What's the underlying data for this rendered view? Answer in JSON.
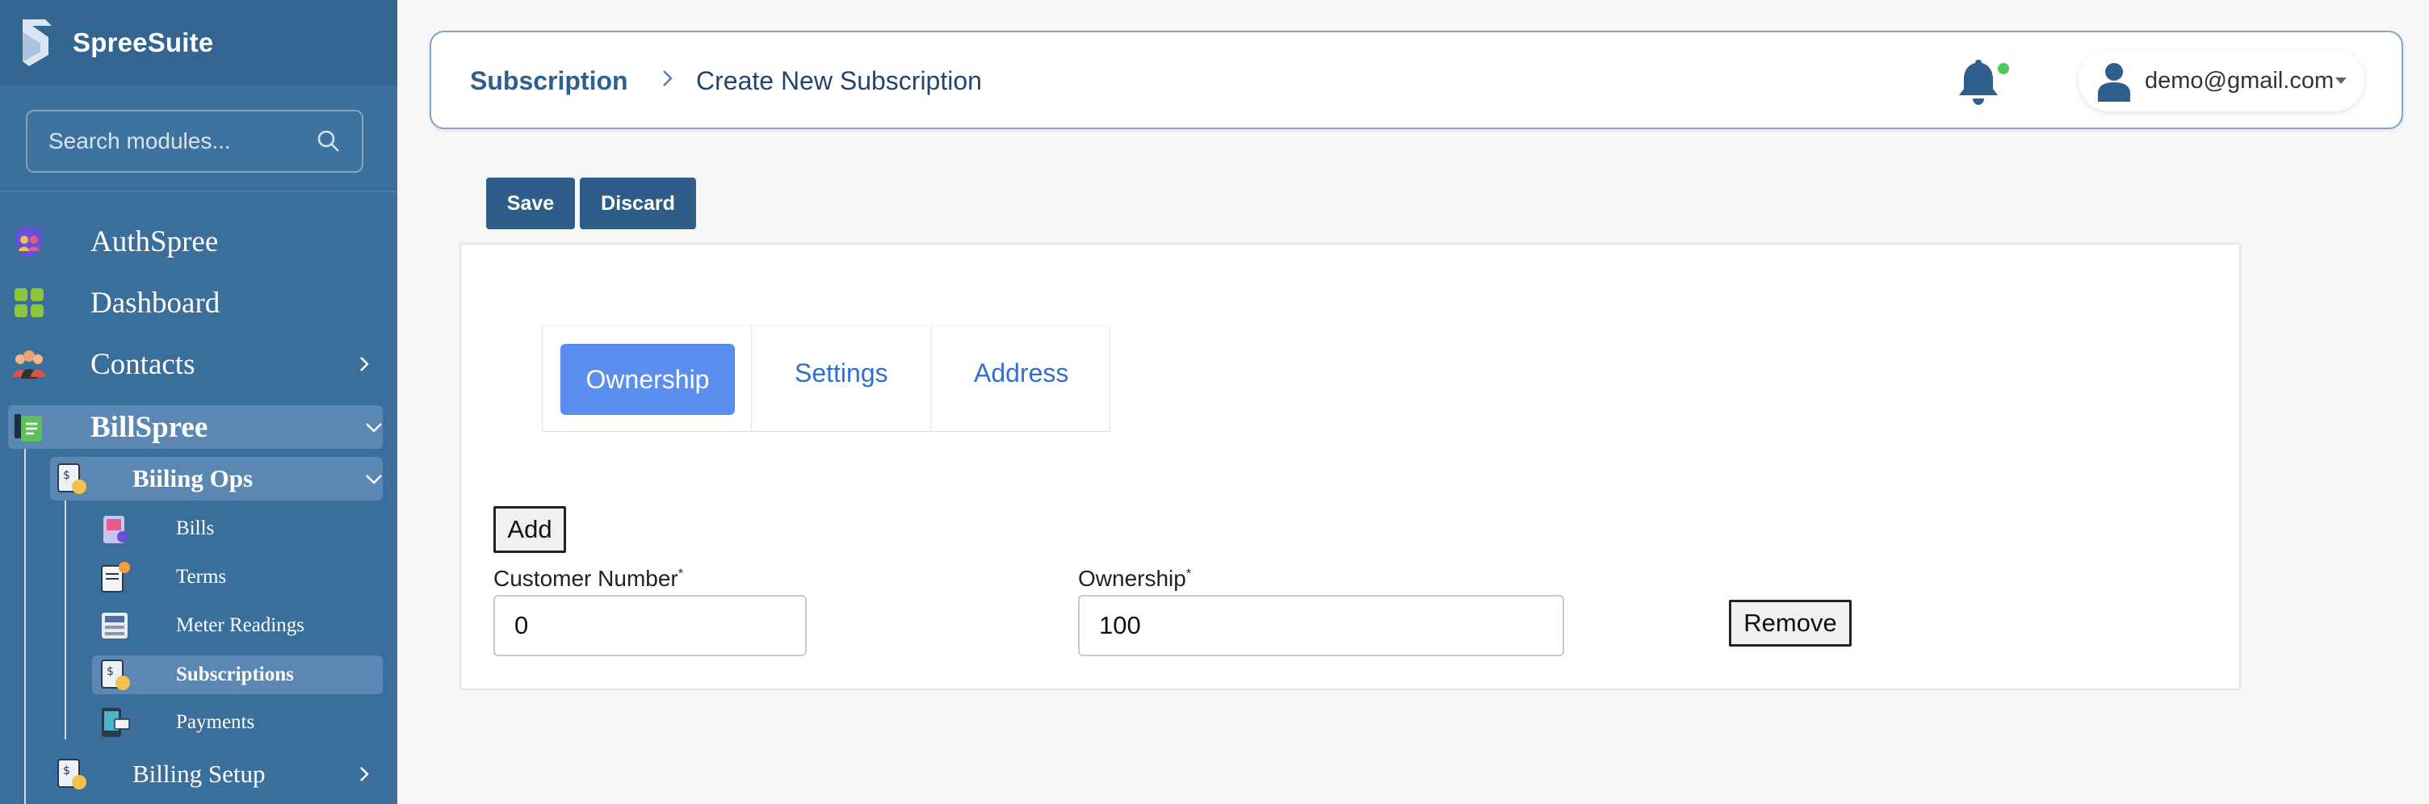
{
  "brand": {
    "name": "SpreeSuite"
  },
  "sidebar": {
    "search_placeholder": "Search modules...",
    "items": [
      {
        "label": "AuthSpree",
        "icon": "shield-users-icon"
      },
      {
        "label": "Dashboard",
        "icon": "dashboard-grid-icon"
      },
      {
        "label": "Contacts",
        "icon": "people-group-icon"
      },
      {
        "label": "BillSpree",
        "icon": "bill-document-icon"
      }
    ],
    "billing_ops": {
      "label": "Biiling Ops"
    },
    "billing_ops_items": [
      {
        "label": "Bills",
        "icon": "bills-icon"
      },
      {
        "label": "Terms",
        "icon": "terms-icon"
      },
      {
        "label": "Meter Readings",
        "icon": "meter-icon"
      },
      {
        "label": "Subscriptions",
        "icon": "subscriptions-icon"
      },
      {
        "label": "Payments",
        "icon": "payments-icon"
      }
    ],
    "billing_setup": {
      "label": "Billing Setup"
    }
  },
  "header": {
    "breadcrumb_main": "Subscription",
    "breadcrumb_sub": "Create New Subscription",
    "user_email": "demo@gmail.com",
    "notification_status_color": "#4ccb5b"
  },
  "actions": {
    "save": "Save",
    "discard": "Discard"
  },
  "tabs": [
    {
      "label": "Ownership",
      "active": true
    },
    {
      "label": "Settings",
      "active": false
    },
    {
      "label": "Address",
      "active": false
    }
  ],
  "form": {
    "add_label": "Add",
    "customer_number_label": "Customer Number",
    "customer_number_value": "0",
    "ownership_label": "Ownership",
    "ownership_value": "100",
    "required_marker": "*",
    "remove_label": "Remove"
  },
  "colors": {
    "sidebar": "#3a6e9b",
    "primary_button": "#2f5d8a",
    "active_tab": "#5a8ff0"
  }
}
